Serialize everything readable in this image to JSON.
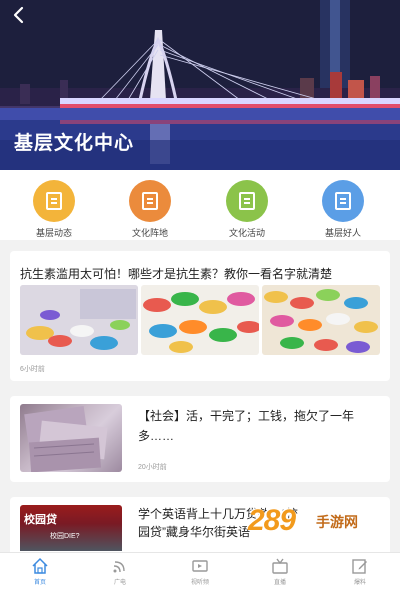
{
  "header": {
    "title": "基层文化中心",
    "back_icon": "chevron-left-icon"
  },
  "categories": [
    {
      "label": "基层动态",
      "color": "#f3b43a",
      "icon": "document-icon"
    },
    {
      "label": "文化阵地",
      "color": "#eb8b3c",
      "icon": "document-icon"
    },
    {
      "label": "文化活动",
      "color": "#8bc34a",
      "icon": "document-icon"
    },
    {
      "label": "基层好人",
      "color": "#5b9ee6",
      "icon": "document-icon"
    }
  ],
  "feed": [
    {
      "title": "抗生素滥用太可怕！哪些才是抗生素？教你一看名字就清楚",
      "time": "6小时前"
    },
    {
      "title": "【社会】活，干完了；工钱，拖欠了一年多……",
      "time": "20小时前"
    },
    {
      "title": "学个英语背上十几万贷款？“校园贷”藏身华尔街英语",
      "thumb_text": "校园贷",
      "thumb_subtext": "校园DIE?"
    }
  ],
  "watermark": {
    "number": "289",
    "text": "手游网"
  },
  "bottom_nav": [
    {
      "label": "首页",
      "icon": "home-icon",
      "active": true
    },
    {
      "label": "广电",
      "icon": "satellite-icon",
      "active": false
    },
    {
      "label": "视听频",
      "icon": "video-icon",
      "active": false
    },
    {
      "label": "直播",
      "icon": "live-icon",
      "active": false
    },
    {
      "label": "爆料",
      "icon": "edit-icon",
      "active": false
    }
  ],
  "colors": {
    "accent": "#3d8be0"
  }
}
